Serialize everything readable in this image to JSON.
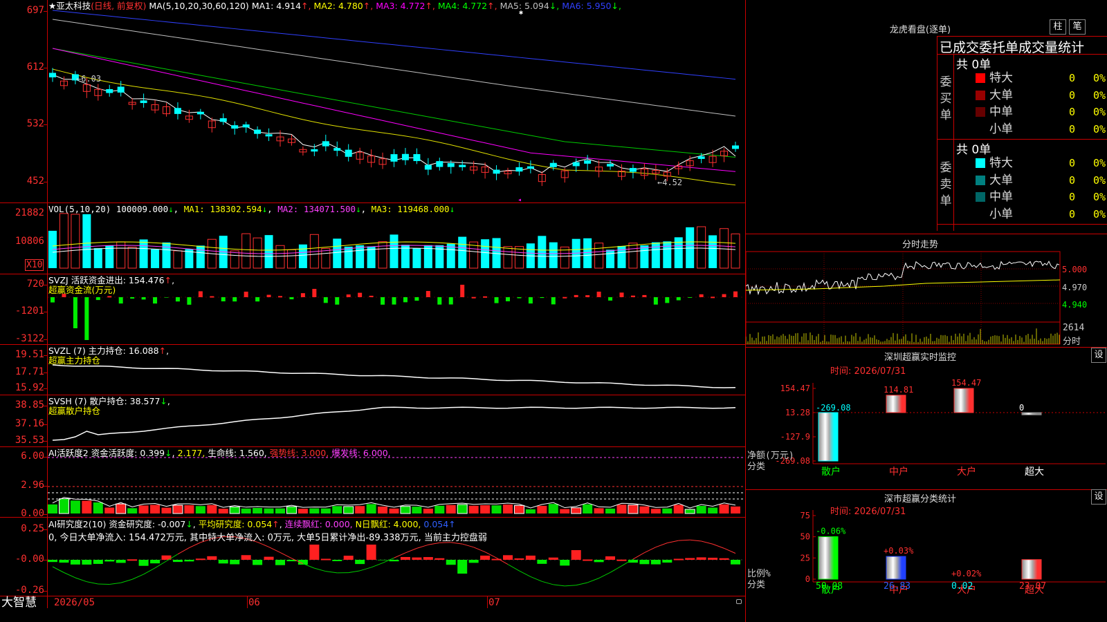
{
  "header": {
    "star": "★",
    "stock_name": "亚太科技",
    "period": "(日线, 前复权)",
    "ma_spec": "MA(5,10,20,30,60,120)",
    "ma_items": [
      {
        "label": "MA1:",
        "value": "4.914",
        "arrow": "↑",
        "color": "#ffffff"
      },
      {
        "label": "MA2:",
        "value": "4.780",
        "arrow": "↑",
        "color": "#ffff00"
      },
      {
        "label": "MA3:",
        "value": "4.772",
        "arrow": "↑",
        "color": "#ff00ff"
      },
      {
        "label": "MA4:",
        "value": "4.772",
        "arrow": "↑",
        "color": "#00ff00"
      },
      {
        "label": "MA5:",
        "value": "5.094",
        "arrow": "↓",
        "color": "#c0c0c0"
      },
      {
        "label": "MA6:",
        "value": "5.950",
        "arrow": "↓",
        "color": "#3040ff"
      }
    ]
  },
  "price_axis": [
    "697",
    "612",
    "532",
    "452"
  ],
  "annotations": {
    "high": "6.03",
    "low": "4.52"
  },
  "volume": {
    "title": "VOL(5,10,20)",
    "value": "100009.000",
    "ma1": "MA1: 138302.594",
    "ma2": "MA2: 134071.500",
    "ma3": "MA3: 119468.000",
    "axis": [
      "21882",
      "10806"
    ],
    "unit": "X10"
  },
  "svzj": {
    "title": "SVZJ  活跃资金进出: 154.476",
    "sub": "超赢资金流(万元)",
    "axis": [
      "720",
      "-1201",
      "-3122"
    ]
  },
  "svzl": {
    "title": "SVZL (7) 主力持仓: 16.088",
    "sub": "超赢主力持仓",
    "axis": [
      "19.51",
      "17.71",
      "15.92"
    ]
  },
  "svsh": {
    "title": "SVSH (7) 散户持仓: 38.577",
    "sub": "超赢散户持仓",
    "axis": [
      "38.85",
      "37.16",
      "35.53"
    ]
  },
  "ai1": {
    "title": "AI活跃度2 资金活跃度: 0.399",
    "v2": "2.177,",
    "life": "生命线: 1.560,",
    "strong": "强势线: 3.000,",
    "burst": "爆发线: 6.000,",
    "axis": [
      "6.00",
      "2.96",
      "0.00"
    ]
  },
  "ai2": {
    "title": "AI研究度2(10) 资金研究度: -0.007",
    "avg": "平均研究度: 0.054",
    "red": "连续飘红: 0.000,",
    "nred": "N日飘红: 4.000,",
    "last": "0.054",
    "note": "0, 今日大单净流入: 154.472万元, 其中特大单净流入: 0万元, 大单5日累计净出-89.338万元, 当前主力控盘弱",
    "axis": [
      "0.25",
      "-0.00",
      "-0.26"
    ]
  },
  "date_axis": {
    "brand": "大智慧",
    "labels": [
      "2026/05",
      "06",
      "07"
    ]
  },
  "right": {
    "title": "龙虎看盘(逐单)",
    "btn1": "柱",
    "btn2": "笔",
    "table_title": "已成交委托单成交量统计",
    "buy": {
      "label": [
        "委",
        "买",
        "单"
      ],
      "total": "共 0单",
      "rows": [
        {
          "name": "特大",
          "n": "0",
          "p": "0%",
          "color": "#ff0000"
        },
        {
          "name": "大单",
          "n": "0",
          "p": "0%",
          "color": "#990000"
        },
        {
          "name": "中单",
          "n": "0",
          "p": "0%",
          "color": "#660000"
        },
        {
          "name": "小单",
          "n": "0",
          "p": "0%",
          "color": "#000000"
        }
      ]
    },
    "sell": {
      "label": [
        "委",
        "卖",
        "单"
      ],
      "total": "共 0单",
      "rows": [
        {
          "name": "特大",
          "n": "0",
          "p": "0%",
          "color": "#00ffff"
        },
        {
          "name": "大单",
          "n": "0",
          "p": "0%",
          "color": "#008080"
        },
        {
          "name": "中单",
          "n": "0",
          "p": "0%",
          "color": "#006666"
        },
        {
          "name": "小单",
          "n": "0",
          "p": "0%",
          "color": "#000000"
        }
      ]
    },
    "intraday": {
      "title": "分时走势",
      "axis": [
        "5.000",
        "4.970",
        "4.940"
      ],
      "vol": "2614",
      "vol_unit": "分时"
    },
    "sz_monitor": {
      "title": "深圳超赢实时监控",
      "set": "设",
      "time": "时间: 2026/07/31",
      "axis": [
        "154.47",
        "13.28",
        "-127.9",
        "-269.08"
      ],
      "ylabel": "净额(万元)",
      "xlabel": "分类"
    },
    "sz_stats": {
      "title": "深市超赢分类统计",
      "set": "设",
      "time": "时间: 2026/07/31",
      "axis": [
        "75",
        "50",
        "25",
        "0"
      ],
      "ylabel": "比例%",
      "xlabel": "分类"
    }
  },
  "chart_data": [
    {
      "type": "bar",
      "title": "深圳超赢实时监控",
      "categories": [
        "散户",
        "中户",
        "大户",
        "超大"
      ],
      "values": [
        -269.08,
        114.81,
        154.47,
        0
      ],
      "ylim": [
        -269.08,
        154.47
      ]
    },
    {
      "type": "bar",
      "title": "深市超赢分类统计",
      "categories": [
        "散户",
        "中户",
        "大户",
        "超大"
      ],
      "values": [
        50.08,
        26.83,
        0.02,
        23.07
      ],
      "changes": [
        "-0.06%",
        "+0.03%",
        "+0.02%",
        ""
      ],
      "ylim": [
        0,
        75
      ]
    }
  ]
}
